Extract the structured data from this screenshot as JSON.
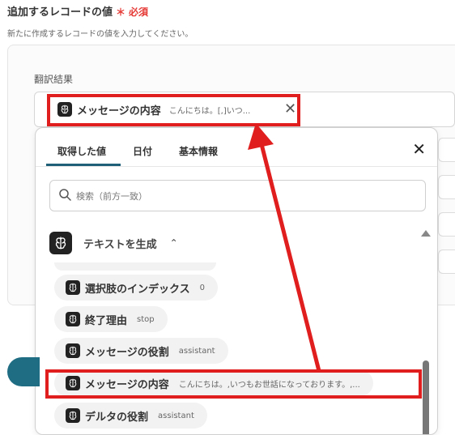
{
  "field": {
    "title": "追加するレコードの値",
    "required_mark": "＊",
    "required_label": "必須",
    "description": "新たに作成するレコードの値を入力してください。"
  },
  "subfield": {
    "label": "翻訳結果",
    "token_label": "メッセージの内容",
    "token_value": "こんにちは。[,]いつ..."
  },
  "picker": {
    "tabs": [
      "取得した値",
      "日付",
      "基本情報"
    ],
    "active_tab": "取得した値",
    "search_placeholder": "検索（前方一致）",
    "section_title": "テキストを生成",
    "items": [
      {
        "label": "選択肢のインデックス",
        "value": "0"
      },
      {
        "label": "終了理由",
        "value": "stop"
      },
      {
        "label": "メッセージの役割",
        "value": "assistant"
      },
      {
        "label": "メッセージの内容",
        "value": "こんにちは。,いつもお世話になっております。,..."
      },
      {
        "label": "デルタの役割",
        "value": "assistant"
      }
    ]
  },
  "icons": [
    "ai-brain-icon",
    "close-icon",
    "search-icon",
    "chevron-up-icon"
  ],
  "colors": {
    "highlight": "#e01e1e",
    "required": "#e53935",
    "accent_teal": "#1f5f77"
  }
}
